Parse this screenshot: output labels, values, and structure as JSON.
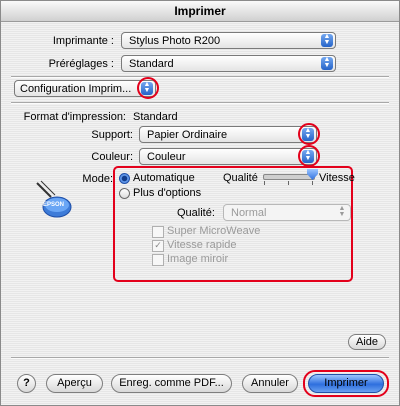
{
  "window": {
    "title": "Imprimer"
  },
  "printer": {
    "label": "Imprimante :",
    "value": "Stylus Photo R200"
  },
  "presets": {
    "label": "Préréglages :",
    "value": "Standard"
  },
  "panel": {
    "value": "Configuration Imprim..."
  },
  "format": {
    "label": "Format d'impression:",
    "value": "Standard"
  },
  "support": {
    "label": "Support:",
    "value": "Papier Ordinaire"
  },
  "color": {
    "label": "Couleur:",
    "value": "Couleur"
  },
  "mode": {
    "label": "Mode:",
    "automatic": "Automatique",
    "more_options": "Plus d'options",
    "selected": "Automatique",
    "slider_left": "Qualité",
    "slider_right": "Vitesse",
    "slider_value": 1.0,
    "quality_label": "Qualité:",
    "quality_value": "Normal"
  },
  "options": [
    {
      "label": "Super MicroWeave",
      "checked": false
    },
    {
      "label": "Vitesse rapide",
      "checked": true
    },
    {
      "label": "Image miroir",
      "checked": false
    }
  ],
  "brand": {
    "logo_text": "EPSON"
  },
  "buttons": {
    "help_small": "Aide",
    "help_icon": "?",
    "preview": "Aperçu",
    "save_pdf": "Enreg. comme PDF...",
    "cancel": "Annuler",
    "print": "Imprimer"
  },
  "colors": {
    "accent": "#2e6fde",
    "highlight": "#e3001b"
  }
}
